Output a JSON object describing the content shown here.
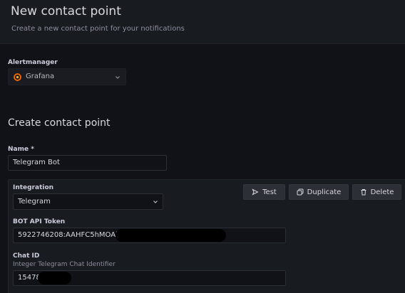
{
  "header": {
    "title": "New contact point",
    "subtitle": "Create a new contact point for your notifications"
  },
  "alertmanager": {
    "label": "Alertmanager",
    "value": "Grafana"
  },
  "section_title": "Create contact point",
  "name_field": {
    "label": "Name *",
    "value": "Telegram Bot"
  },
  "integration": {
    "label": "Integration",
    "value": "Telegram"
  },
  "actions": {
    "test": "Test",
    "duplicate": "Duplicate",
    "delete": "Delete"
  },
  "bot_token": {
    "label": "BOT API Token",
    "value": "5922746208:AAHFC5hMOAi"
  },
  "chat_id": {
    "label": "Chat ID",
    "description": "Integer Telegram Chat Identifier",
    "value": "15478"
  },
  "colors": {
    "background": "#111217",
    "panel": "#181b1f",
    "button": "#2d2f36",
    "grafana_orange": "#f46800"
  }
}
